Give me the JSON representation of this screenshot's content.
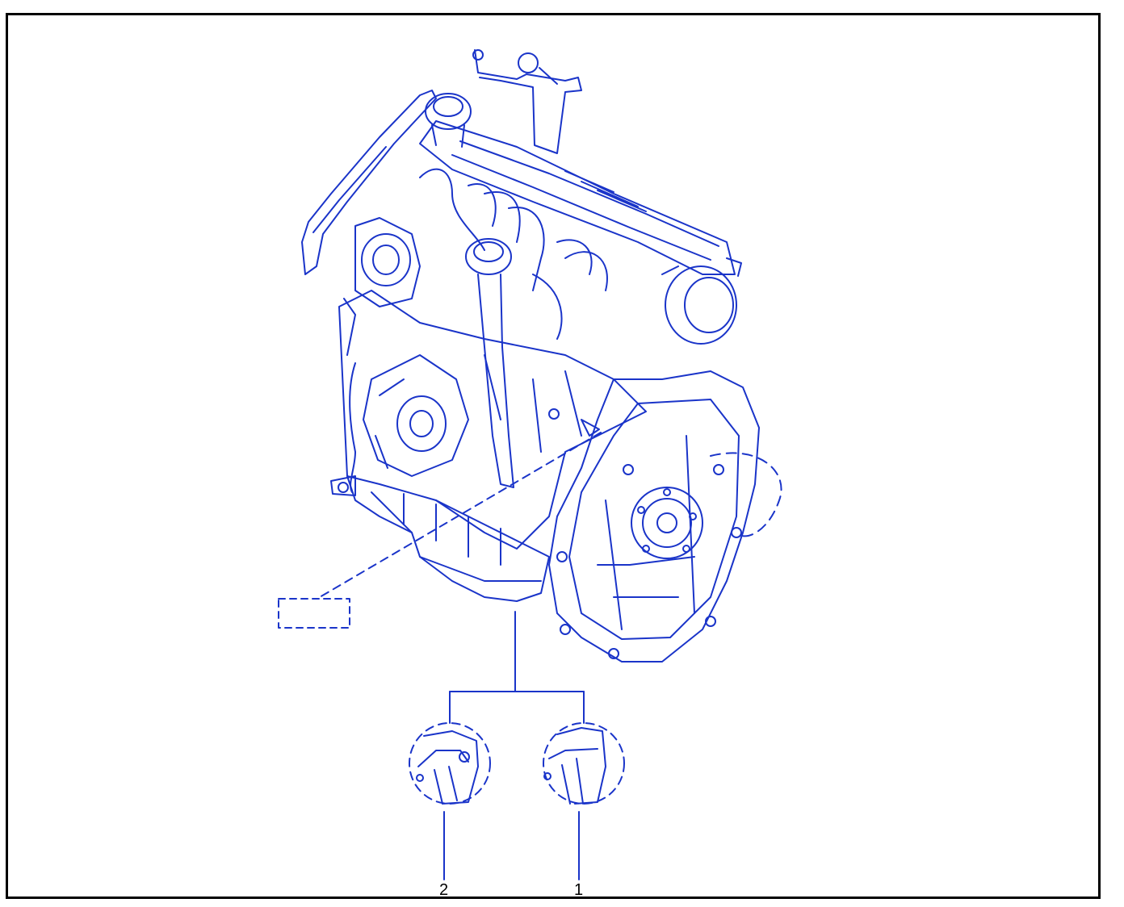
{
  "colors": {
    "line": "#1a34c9",
    "frame": "#000000",
    "background": "#ffffff"
  },
  "callouts": [
    {
      "id": "1",
      "label": "1"
    },
    {
      "id": "2",
      "label": "2"
    }
  ],
  "parts": [
    {
      "id": "engine-assembly",
      "icon": "engine-block-drawing"
    },
    {
      "id": "detail-1",
      "icon": "gasket-detail-circle"
    },
    {
      "id": "detail-2",
      "icon": "gasket-detail-circle"
    },
    {
      "id": "id-plate",
      "icon": "dashed-label-box"
    }
  ]
}
